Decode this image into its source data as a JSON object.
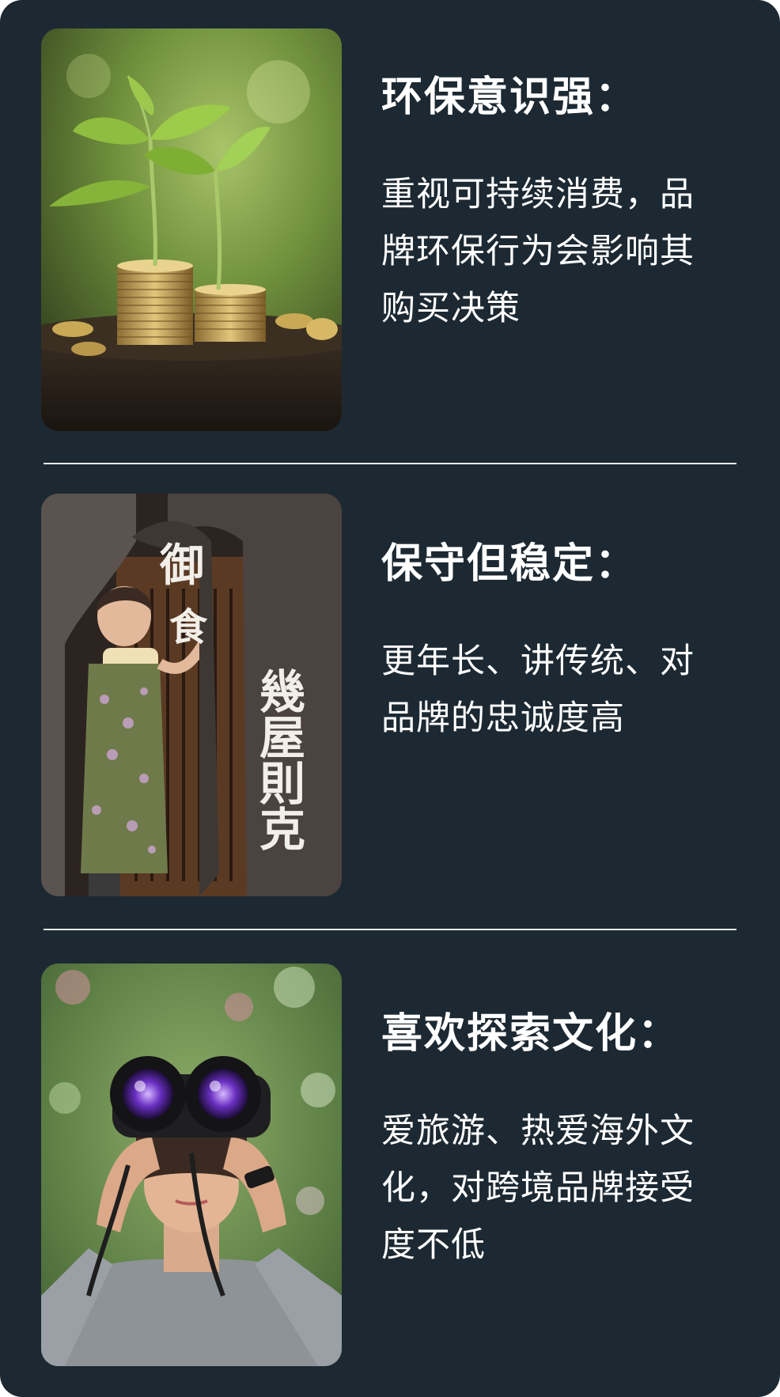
{
  "sections": [
    {
      "image": "plant-sprouting-from-coins-photo",
      "title": "环保意识强：",
      "description": "重视可持续消费，品牌环保行为会影响其购买决策"
    },
    {
      "image": "woman-behind-noren-curtain-photo",
      "title": "保守但稳定：",
      "description": "更年长、讲传统、对品牌的忠诚度高",
      "curtain_text": [
        "御",
        "食",
        "幾屋則克"
      ]
    },
    {
      "image": "woman-with-binoculars-photo",
      "title": "喜欢探索文化：",
      "description": "爱旅游、热爱海外文化，对跨境品牌接受度不低"
    }
  ],
  "colors": {
    "background": "#1d2932",
    "text": "#ffffff",
    "divider": "#e9ecee"
  }
}
